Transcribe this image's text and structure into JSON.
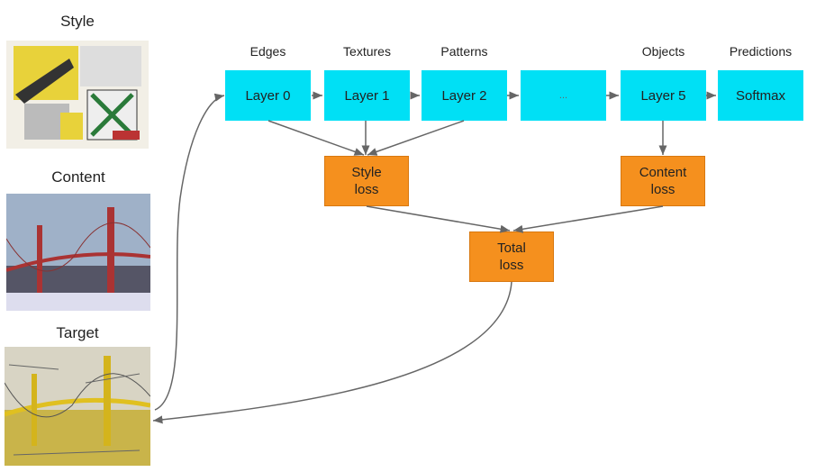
{
  "images": {
    "style": "Style",
    "content": "Content",
    "target": "Target"
  },
  "layer_labels": [
    "Edges",
    "Textures",
    "Patterns",
    "Objects",
    "Predictions"
  ],
  "layers": [
    "Layer 0",
    "Layer 1",
    "Layer 2",
    "...",
    "Layer 5",
    "Softmax"
  ],
  "losses": {
    "style": "Style loss",
    "content": "Content loss",
    "total": "Total loss"
  },
  "colors": {
    "layer": "#00e0f5",
    "loss": "#f5901e",
    "arrow": "#666666"
  }
}
